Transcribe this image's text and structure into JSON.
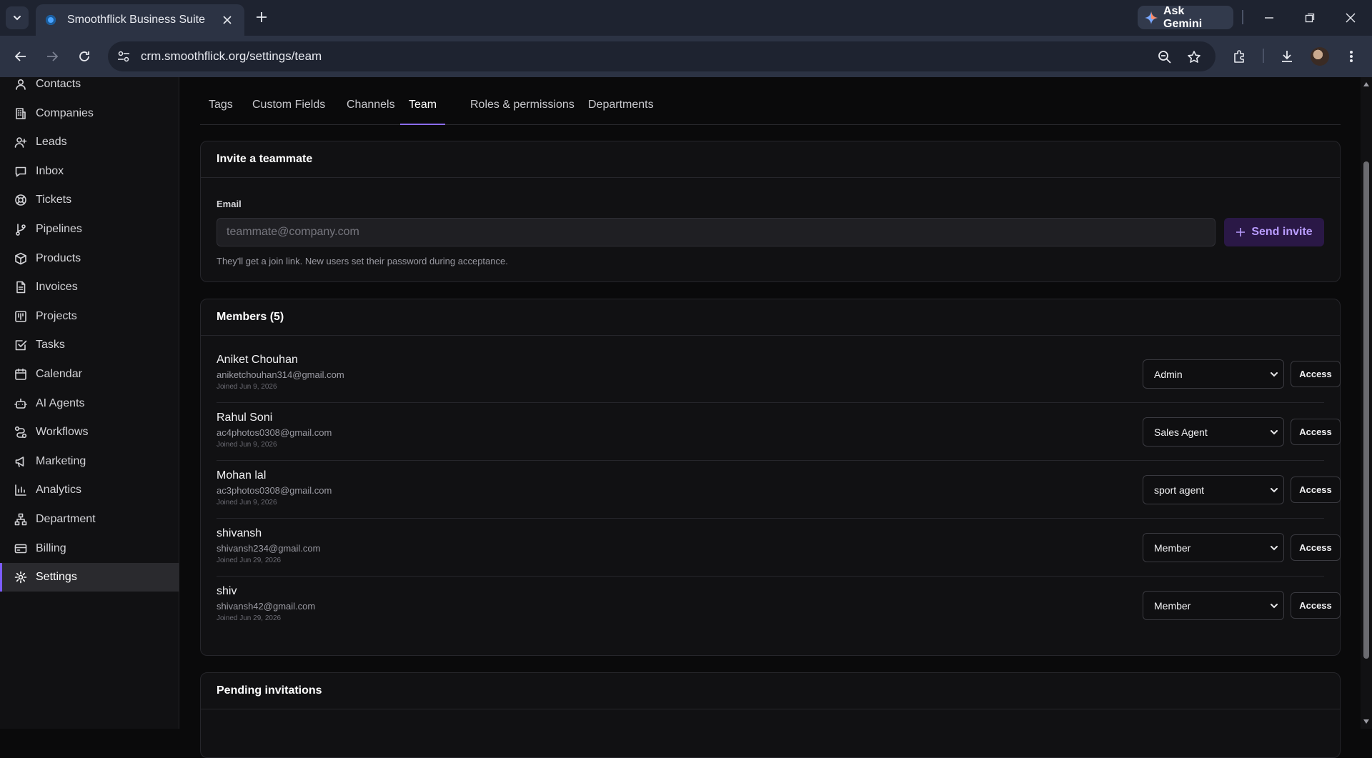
{
  "browser": {
    "tab_title": "Smoothflick Business Suite",
    "gemini_label": "Ask Gemini",
    "url": "crm.smoothflick.org/settings/team"
  },
  "sidebar": {
    "items": [
      {
        "label": "Contacts",
        "icon": "user-icon"
      },
      {
        "label": "Companies",
        "icon": "building-icon"
      },
      {
        "label": "Leads",
        "icon": "user-plus-icon"
      },
      {
        "label": "Inbox",
        "icon": "message-icon"
      },
      {
        "label": "Tickets",
        "icon": "lifebuoy-icon"
      },
      {
        "label": "Pipelines",
        "icon": "git-branch-icon"
      },
      {
        "label": "Products",
        "icon": "box-icon"
      },
      {
        "label": "Invoices",
        "icon": "file-icon"
      },
      {
        "label": "Projects",
        "icon": "kanban-icon"
      },
      {
        "label": "Tasks",
        "icon": "check-square-icon"
      },
      {
        "label": "Calendar",
        "icon": "calendar-icon"
      },
      {
        "label": "AI Agents",
        "icon": "bot-icon"
      },
      {
        "label": "Workflows",
        "icon": "workflow-icon"
      },
      {
        "label": "Marketing",
        "icon": "megaphone-icon"
      },
      {
        "label": "Analytics",
        "icon": "bar-chart-icon"
      },
      {
        "label": "Department",
        "icon": "network-icon"
      },
      {
        "label": "Billing",
        "icon": "credit-card-icon"
      },
      {
        "label": "Settings",
        "icon": "gear-icon",
        "active": true
      }
    ]
  },
  "settings_tabs": [
    "Tags",
    "Custom Fields",
    "Channels",
    "Team",
    "Roles & permissions",
    "Departments"
  ],
  "active_tab": "Team",
  "invite": {
    "title": "Invite a teammate",
    "email_label": "Email",
    "email_value": "",
    "email_placeholder": "teammate@company.com",
    "send_label": "Send invite",
    "hint": "They'll get a join link. New users set their password during acceptance."
  },
  "members": {
    "title": "Members (5)",
    "access_label": "Access",
    "rows": [
      {
        "name": "Aniket Chouhan",
        "email": "aniketchouhan314@gmail.com",
        "joined": "Joined Jun 9, 2026",
        "role": "Admin"
      },
      {
        "name": "Rahul Soni",
        "email": "ac4photos0308@gmail.com",
        "joined": "Joined Jun 9, 2026",
        "role": "Sales Agent"
      },
      {
        "name": "Mohan lal",
        "email": "ac3photos0308@gmail.com",
        "joined": "Joined Jun 9, 2026",
        "role": "sport agent"
      },
      {
        "name": "shivansh",
        "email": "shivansh234@gmail.com",
        "joined": "Joined Jun 29, 2026",
        "role": "Member"
      },
      {
        "name": "shiv",
        "email": "shivansh42@gmail.com",
        "joined": "Joined Jun 29, 2026",
        "role": "Member"
      }
    ]
  },
  "pending": {
    "title": "Pending invitations"
  },
  "colors": {
    "accent": "#8b6cff",
    "send_button_bg": "#2a1846",
    "send_button_text": "#b99cff",
    "sidebar_bg": "#111113",
    "page_bg": "#0a0a0b"
  }
}
